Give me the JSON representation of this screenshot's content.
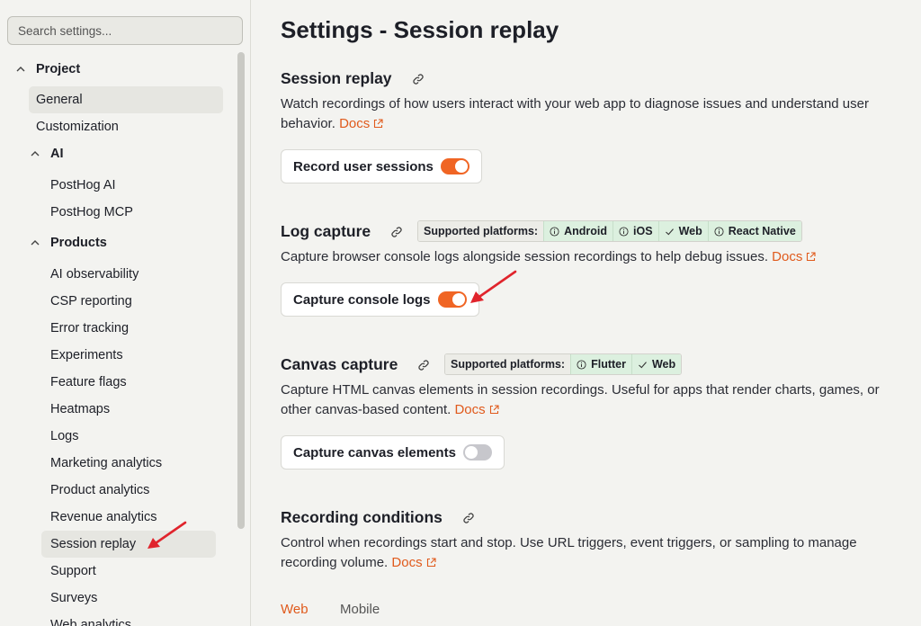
{
  "search": {
    "placeholder": "Search settings..."
  },
  "sidebar": {
    "groups": {
      "project": "Project",
      "ai": "AI",
      "products": "Products"
    },
    "items": {
      "general": "General",
      "customization": "Customization",
      "posthog_ai": "PostHog AI",
      "posthog_mcp": "PostHog MCP",
      "ai_observability": "AI observability",
      "csp_reporting": "CSP reporting",
      "error_tracking": "Error tracking",
      "experiments": "Experiments",
      "feature_flags": "Feature flags",
      "heatmaps": "Heatmaps",
      "logs": "Logs",
      "marketing_analytics": "Marketing analytics",
      "product_analytics": "Product analytics",
      "revenue_analytics": "Revenue analytics",
      "session_replay": "Session replay",
      "support": "Support",
      "surveys": "Surveys",
      "web_analytics": "Web analytics"
    }
  },
  "main": {
    "title": "Settings - Session replay",
    "docs_label": "Docs",
    "session_replay": {
      "title": "Session replay",
      "desc": "Watch recordings of how users interact with your web app to diagnose issues and understand user behavior.",
      "toggle_label": "Record user sessions",
      "toggle_on": true
    },
    "log_capture": {
      "title": "Log capture",
      "platforms_label": "Supported platforms:",
      "platforms": [
        "Android",
        "iOS",
        "Web",
        "React Native"
      ],
      "desc": "Capture browser console logs alongside session recordings to help debug issues.",
      "toggle_label": "Capture console logs",
      "toggle_on": true
    },
    "canvas_capture": {
      "title": "Canvas capture",
      "platforms_label": "Supported platforms:",
      "platforms": [
        "Flutter",
        "Web"
      ],
      "desc": "Capture HTML canvas elements in session recordings. Useful for apps that render charts, games, or other canvas-based content.",
      "toggle_label": "Capture canvas elements",
      "toggle_on": false
    },
    "recording_conditions": {
      "title": "Recording conditions",
      "desc": "Control when recordings start and stop. Use URL triggers, event triggers, or sampling to manage recording volume."
    },
    "tabs": [
      "Web",
      "Mobile"
    ]
  },
  "colors": {
    "accent": "#f06524",
    "link": "#e05a1c",
    "annotation_arrow": "#e0242c",
    "platform_chip": "#dcf0df"
  }
}
